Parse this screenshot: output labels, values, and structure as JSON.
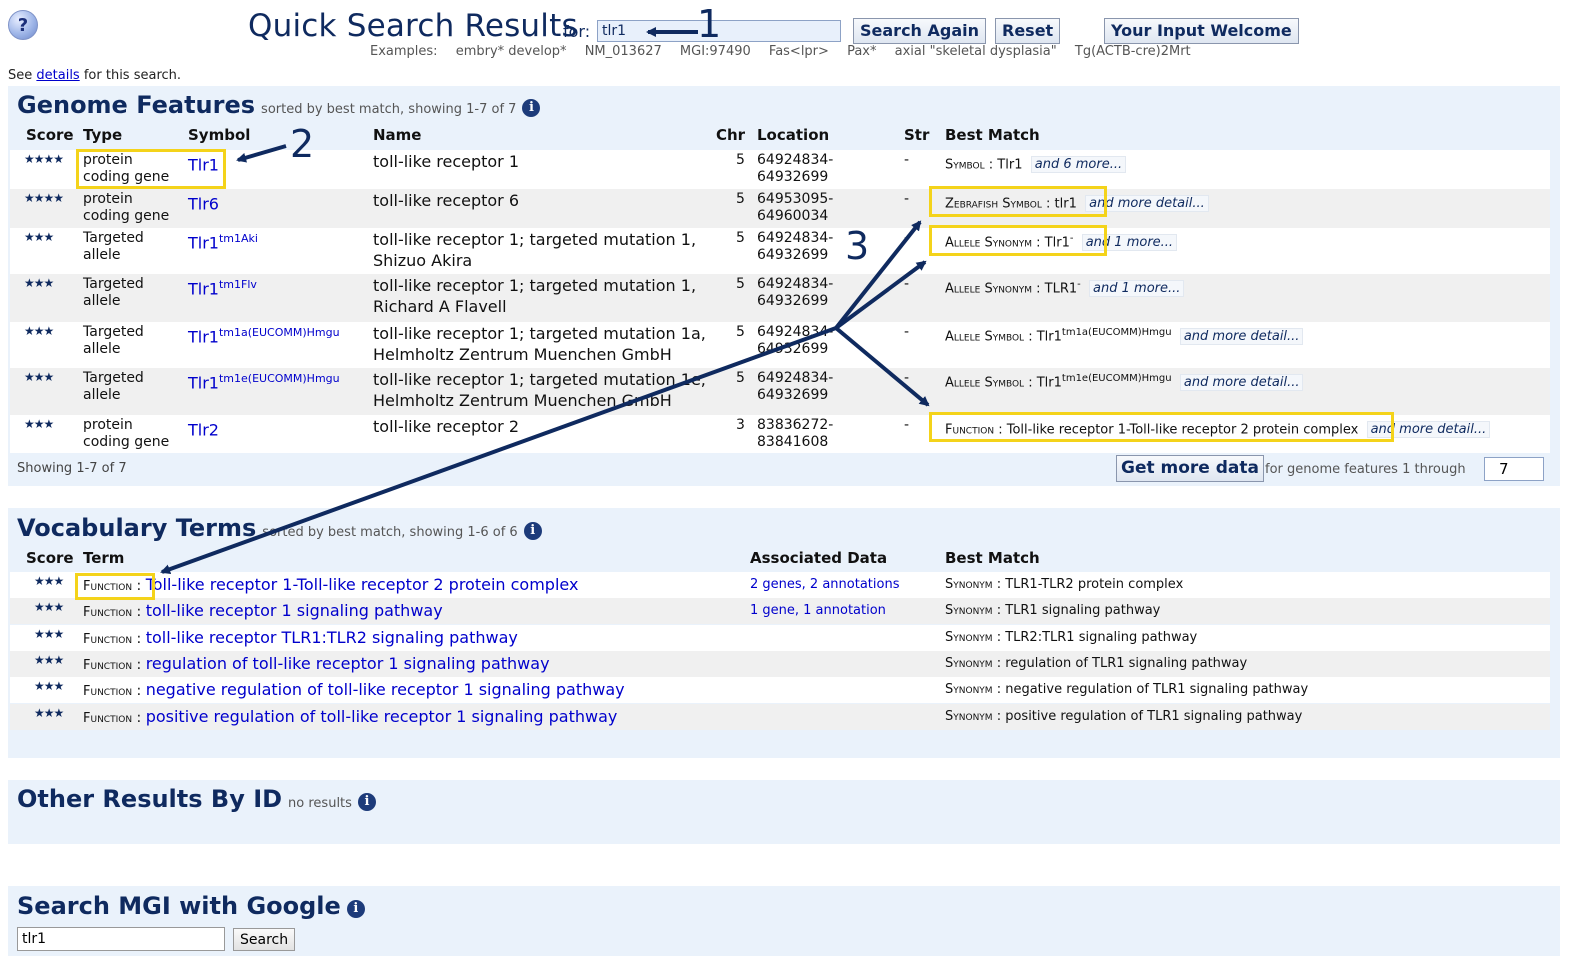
{
  "header": {
    "title": "Quick Search Results",
    "for_label": "for:",
    "query": "tlr1",
    "buttons": {
      "search_again": "Search Again",
      "reset": "Reset",
      "input_welcome": "Your Input Welcome"
    },
    "examples_label": "Examples:",
    "examples": [
      "embry* develop*",
      "NM_013627",
      "MGI:97490",
      "Fas<lpr>",
      "Pax*",
      "axial \"skeletal dysplasia\"",
      "Tg(ACTB-cre)2Mrt"
    ],
    "see_prefix": "See",
    "see_link": "details",
    "see_suffix": "for this search."
  },
  "genome": {
    "title": "Genome Features",
    "subtitle": "sorted by best match, showing 1-7 of 7",
    "columns": {
      "score": "Score",
      "type": "Type",
      "symbol": "Symbol",
      "name": "Name",
      "chr": "Chr",
      "location": "Location",
      "str": "Str",
      "best": "Best Match"
    },
    "rows": [
      {
        "score": "★★★★",
        "type": "protein coding gene",
        "symbol": "Tlr1",
        "sup": "",
        "name": "toll-like receptor 1",
        "chr": "5",
        "loc": "64924834-64932699",
        "str": "-",
        "bm_field": "Symbol",
        "bm_sep": " : ",
        "bm_val": "Tlr1",
        "bm_sup": "",
        "more": "and 6 more..."
      },
      {
        "score": "★★★★",
        "type": "protein coding gene",
        "symbol": "Tlr6",
        "sup": "",
        "name": "toll-like receptor 6",
        "chr": "5",
        "loc": "64953095-64960034",
        "str": "-",
        "bm_field": "Zebrafish Symbol",
        "bm_sep": " : ",
        "bm_val": "tlr1",
        "bm_sup": "",
        "more": "and more detail..."
      },
      {
        "score": "★★★",
        "type": "Targeted allele",
        "symbol": "Tlr1",
        "sup": "tm1Aki",
        "name": "toll-like receptor 1; targeted mutation 1, Shizuo Akira",
        "chr": "5",
        "loc": "64924834-64932699",
        "str": "-",
        "bm_field": "Allele Synonym",
        "bm_sep": " : ",
        "bm_val": "Tlr1",
        "bm_sup": "-",
        "more": "and 1 more..."
      },
      {
        "score": "★★★",
        "type": "Targeted allele",
        "symbol": "Tlr1",
        "sup": "tm1Flv",
        "name": "toll-like receptor 1; targeted mutation 1, Richard A Flavell",
        "chr": "5",
        "loc": "64924834-64932699",
        "str": "-",
        "bm_field": "Allele Synonym",
        "bm_sep": " : ",
        "bm_val": "TLR1",
        "bm_sup": "-",
        "more": "and 1 more..."
      },
      {
        "score": "★★★",
        "type": "Targeted allele",
        "symbol": "Tlr1",
        "sup": "tm1a(EUCOMM)Hmgu",
        "name": "toll-like receptor 1; targeted mutation 1a, Helmholtz Zentrum Muenchen GmbH",
        "chr": "5",
        "loc": "64924834-64932699",
        "str": "-",
        "bm_field": "Allele Symbol",
        "bm_sep": " : ",
        "bm_val": "Tlr1",
        "bm_sup": "tm1a(EUCOMM)Hmgu",
        "more": "and more detail..."
      },
      {
        "score": "★★★",
        "type": "Targeted allele",
        "symbol": "Tlr1",
        "sup": "tm1e(EUCOMM)Hmgu",
        "name": "toll-like receptor 1; targeted mutation 1e, Helmholtz Zentrum Muenchen GmbH",
        "chr": "5",
        "loc": "64924834-64932699",
        "str": "-",
        "bm_field": "Allele Symbol",
        "bm_sep": " : ",
        "bm_val": "Tlr1",
        "bm_sup": "tm1e(EUCOMM)Hmgu",
        "more": "and more detail..."
      },
      {
        "score": "★★★",
        "type": "protein coding gene",
        "symbol": "Tlr2",
        "sup": "",
        "name": "toll-like receptor 2",
        "chr": "3",
        "loc": "83836272-83841608",
        "str": "-",
        "bm_field": "Function",
        "bm_sep": " : ",
        "bm_val": "Toll-like receptor 1-Toll-like receptor 2 protein complex",
        "bm_sup": "",
        "more": "and more detail..."
      }
    ],
    "showing": "Showing 1-7 of 7",
    "get_more": "Get more data",
    "for_features": "for genome features 1 through",
    "through_value": "7"
  },
  "vocab": {
    "title": "Vocabulary Terms",
    "subtitle": "sorted by best match, showing 1-6 of 6",
    "columns": {
      "score": "Score",
      "term": "Term",
      "assoc": "Associated Data",
      "best": "Best Match"
    },
    "rows": [
      {
        "score": "★★★",
        "kind": "Function",
        "sep": " : ",
        "term": "Toll-like receptor 1-Toll-like receptor 2 protein complex",
        "assoc": "2 genes, 2 annotations",
        "bm_field": "Synonym",
        "bm_sep": " : ",
        "bm_val": "TLR1-TLR2 protein complex"
      },
      {
        "score": "★★★",
        "kind": "Function",
        "sep": " : ",
        "term": "toll-like receptor 1 signaling pathway",
        "assoc": "1 gene, 1 annotation",
        "bm_field": "Synonym",
        "bm_sep": " : ",
        "bm_val": "TLR1 signaling pathway"
      },
      {
        "score": "★★★",
        "kind": "Function",
        "sep": " : ",
        "term": "toll-like receptor TLR1:TLR2 signaling pathway",
        "assoc": "",
        "bm_field": "Synonym",
        "bm_sep": " : ",
        "bm_val": "TLR2:TLR1 signaling pathway"
      },
      {
        "score": "★★★",
        "kind": "Function",
        "sep": " : ",
        "term": "regulation of toll-like receptor 1 signaling pathway",
        "assoc": "",
        "bm_field": "Synonym",
        "bm_sep": " : ",
        "bm_val": "regulation of TLR1 signaling pathway"
      },
      {
        "score": "★★★",
        "kind": "Function",
        "sep": " : ",
        "term": "negative regulation of toll-like receptor 1 signaling pathway",
        "assoc": "",
        "bm_field": "Synonym",
        "bm_sep": " : ",
        "bm_val": "negative regulation of TLR1 signaling pathway"
      },
      {
        "score": "★★★",
        "kind": "Function",
        "sep": " : ",
        "term": "positive regulation of toll-like receptor 1 signaling pathway",
        "assoc": "",
        "bm_field": "Synonym",
        "bm_sep": " : ",
        "bm_val": "positive regulation of TLR1 signaling pathway"
      }
    ]
  },
  "other": {
    "title": "Other Results By ID",
    "subtitle": "no results"
  },
  "google": {
    "title": "Search MGI with Google",
    "query": "tlr1",
    "button": "Search"
  },
  "annotations": {
    "n1": "1",
    "n2": "2",
    "n3": "3"
  },
  "colors": {
    "brand": "#0f2a5f",
    "link": "#0000cc",
    "highlight": "#f4d31a",
    "panel": "#eaf2fb"
  }
}
